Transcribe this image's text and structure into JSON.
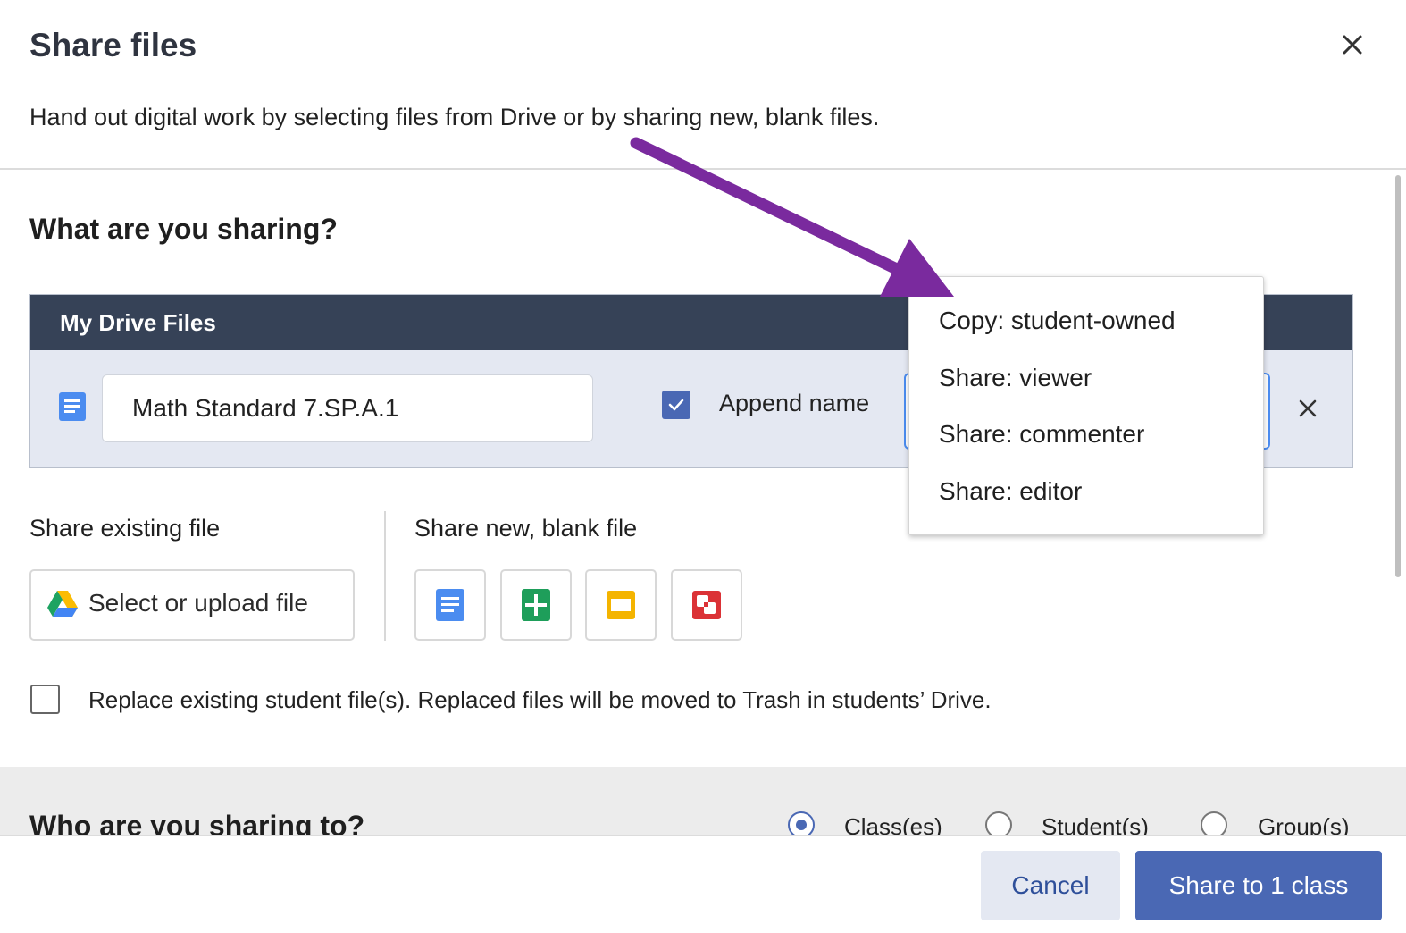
{
  "dialog": {
    "title": "Share files",
    "subtitle": "Hand out digital work by selecting files from Drive or by sharing new, blank files.",
    "close_icon": "close-icon"
  },
  "sharing": {
    "question": "What are you sharing?",
    "files_header": "My Drive Files",
    "file": {
      "icon": "google-docs-icon",
      "name": "Math Standard 7.SP.A.1",
      "append_checked": true,
      "append_label": "Append name"
    },
    "mode_options": [
      "Copy: student-owned",
      "Share: viewer",
      "Share: commenter",
      "Share: editor"
    ],
    "existing_label": "Share existing file",
    "select_file_label": "Select or upload file",
    "new_label": "Share new, blank file",
    "new_file_types": [
      "google-docs-icon",
      "google-sheets-icon",
      "google-slides-icon",
      "google-drawings-icon"
    ],
    "replace_checked": false,
    "replace_label": "Replace existing student file(s). Replaced files will be moved to Trash in students’ Drive."
  },
  "recipients": {
    "question": "Who are you sharing to?",
    "options": [
      "Class(es)",
      "Student(s)",
      "Group(s)"
    ],
    "selected": "Class(es)"
  },
  "footer": {
    "cancel_label": "Cancel",
    "share_label": "Share to 1 class"
  },
  "colors": {
    "header_bar": "#364257",
    "primary": "#4a68b4",
    "annotation_arrow": "#7a2a9e"
  }
}
